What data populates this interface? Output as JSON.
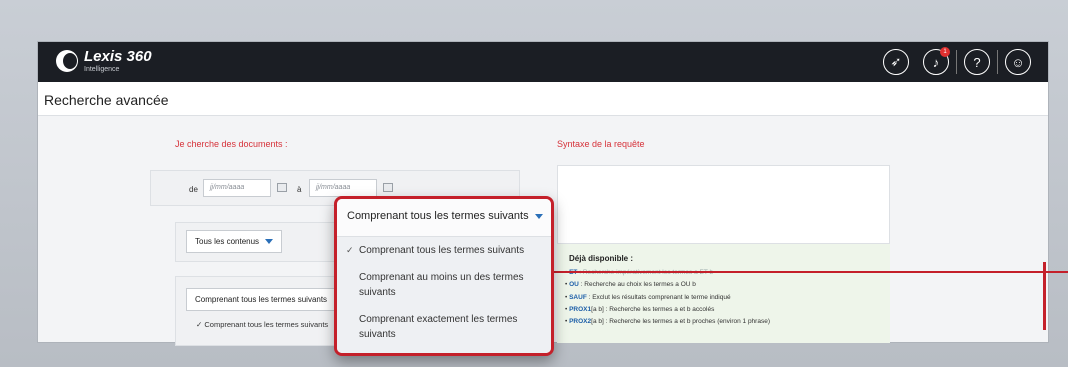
{
  "app": {
    "brand": "Lexis 360",
    "brand_sub": "Intelligence",
    "notification_count": "1"
  },
  "page": {
    "title": "Recherche avancée"
  },
  "search": {
    "section_label": "Je cherche des documents :",
    "date_from_label": "de",
    "date_to_label": "à",
    "date_placeholder": "jj/mm/aaaa",
    "content_select": "Tous les contenus",
    "terms_select": "Comprenant tous les termes suivants",
    "terms_option_first": "Comprenant tous les termes suivants"
  },
  "syntax": {
    "section_label": "Syntaxe de la requête",
    "available_title": "Déjà disponible :",
    "help_lines": [
      {
        "op": "ET",
        "text": " : Recherche impérativement les termes a ET b"
      },
      {
        "op": "OU",
        "text": " : Recherche au choix les termes a OU b"
      },
      {
        "op": "SAUF",
        "text": " : Exclut les résultats comprenant le terme indiqué"
      },
      {
        "op": "PROX1",
        "text": "[a b] : Recherche les termes a et b accolés"
      },
      {
        "op": "PROX2",
        "text": "[a b] : Recherche les termes a et b proches (environ 1 phrase)"
      }
    ]
  },
  "dropdown": {
    "selected": "Comprenant tous les termes suivants",
    "options": [
      {
        "label": "Comprenant tous les termes suivants",
        "checked": true
      },
      {
        "label": "Comprenant au moins un des termes suivants",
        "checked": false
      },
      {
        "label": "Comprenant exactement les termes suivants",
        "checked": false
      }
    ]
  },
  "colors": {
    "accent_red": "#c4202a",
    "topbar": "#1b1e24",
    "link_blue": "#1d5fa8"
  }
}
